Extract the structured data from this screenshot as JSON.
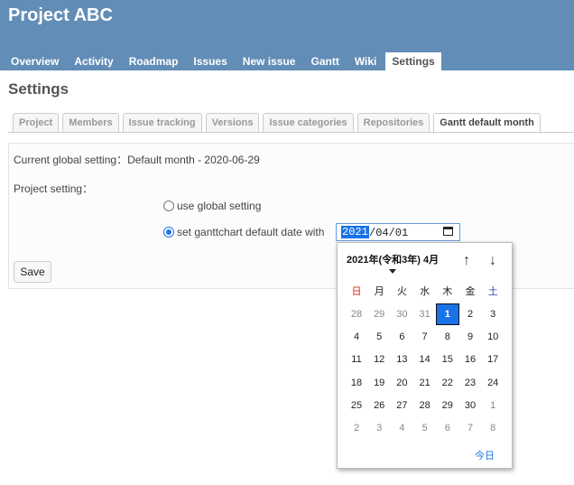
{
  "header": {
    "title": "Project ABC"
  },
  "menu": [
    "Overview",
    "Activity",
    "Roadmap",
    "Issues",
    "New issue",
    "Gantt",
    "Wiki",
    "Settings"
  ],
  "page_title": "Settings",
  "tabs": [
    "Project",
    "Members",
    "Issue tracking",
    "Versions",
    "Issue categories",
    "Repositories",
    "Gantt default month"
  ],
  "form": {
    "current_global": "Current global setting：Default month - 2020-06-29",
    "project_setting": "Project setting：",
    "option_global": "use global setting",
    "option_custom": "set ganttchart default date with",
    "date_year": "2021",
    "date_rest": "/04/01",
    "save_label": "Save"
  },
  "calendar": {
    "month_label": "2021年(令和3年) 4月",
    "up_arrow": "↑",
    "down_arrow": "↓",
    "weekdays": [
      "日",
      "月",
      "火",
      "水",
      "木",
      "金",
      "土"
    ],
    "weeks": [
      [
        "28",
        "29",
        "30",
        "31",
        "1",
        "2",
        "3"
      ],
      [
        "4",
        "5",
        "6",
        "7",
        "8",
        "9",
        "10"
      ],
      [
        "11",
        "12",
        "13",
        "14",
        "15",
        "16",
        "17"
      ],
      [
        "18",
        "19",
        "20",
        "21",
        "22",
        "23",
        "24"
      ],
      [
        "25",
        "26",
        "27",
        "28",
        "29",
        "30",
        "1"
      ],
      [
        "2",
        "3",
        "4",
        "5",
        "6",
        "7",
        "8"
      ]
    ],
    "other_month_rows": {
      "0": [
        0,
        1,
        2,
        3
      ],
      "4": [
        6
      ],
      "5": [
        0,
        1,
        2,
        3,
        4,
        5,
        6
      ]
    },
    "selected": [
      0,
      4
    ],
    "today_label": "今日",
    "colors": {
      "sunday": "#dd2211",
      "saturday": "#2a44c8",
      "selected": "#1a73e8"
    }
  },
  "colors": {
    "header_bg": "#628db6"
  }
}
